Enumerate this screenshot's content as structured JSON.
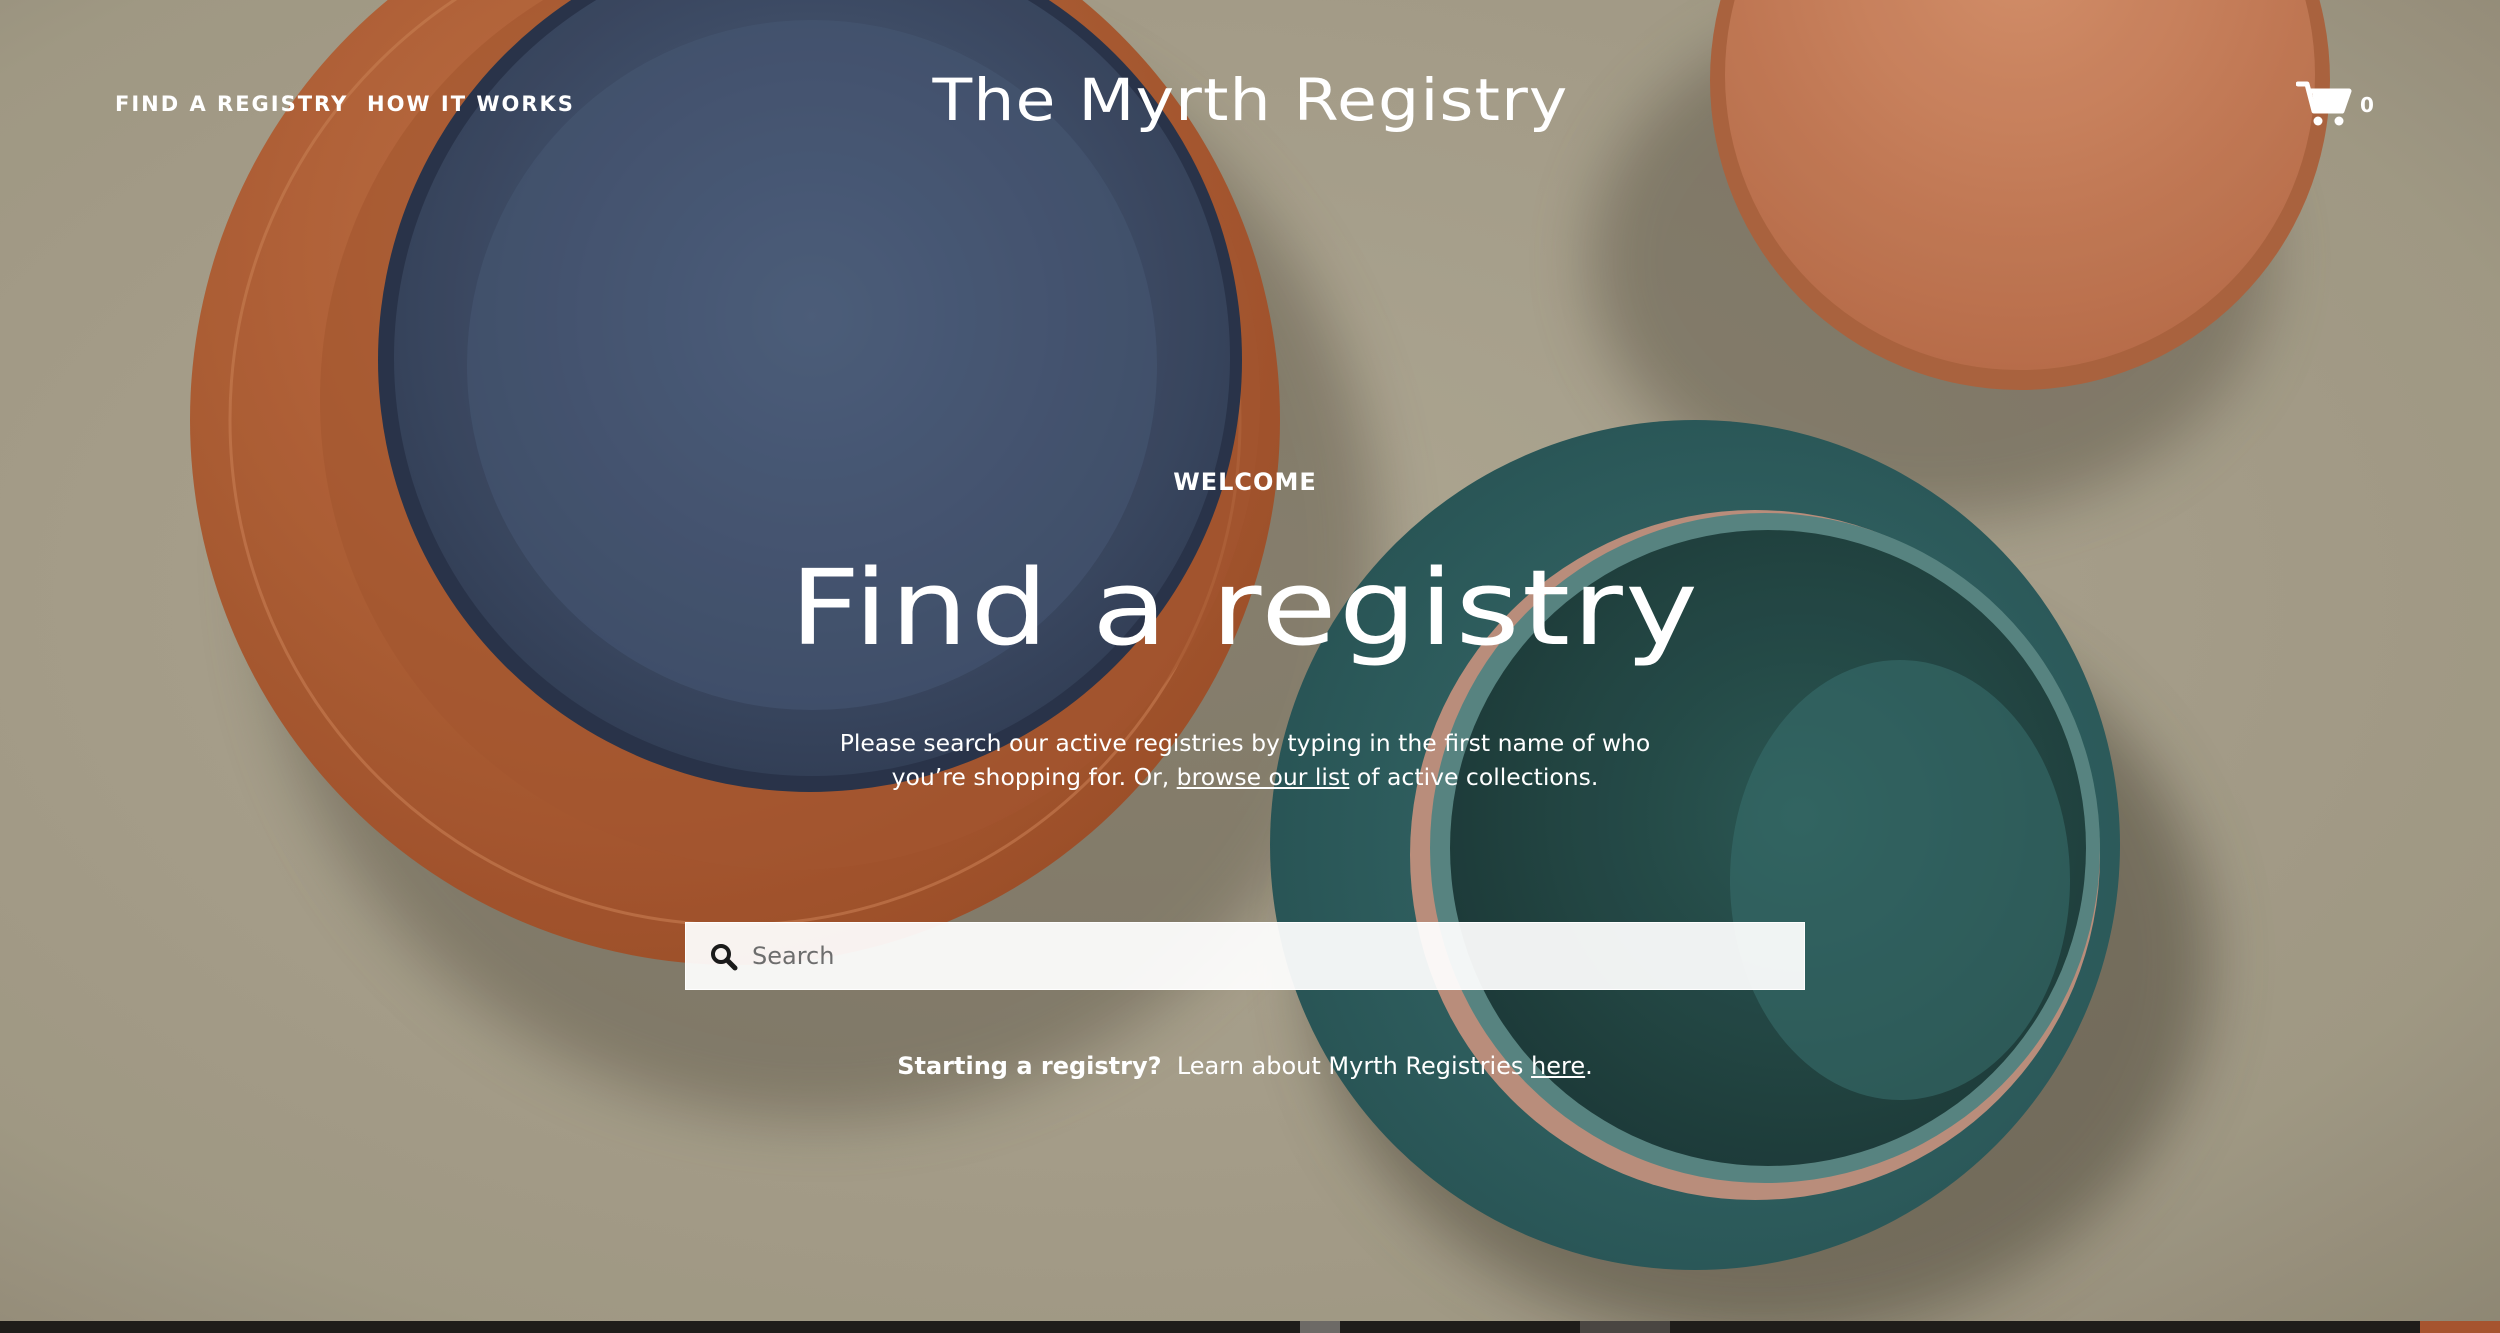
{
  "nav": {
    "find_registry": "FIND A REGISTRY",
    "how_it_works": "HOW IT WORKS"
  },
  "brand": {
    "name": "The Myrth Registry"
  },
  "cart": {
    "icon": "cart-icon",
    "count": "0"
  },
  "hero": {
    "eyebrow": "WELCOME",
    "title": "Find a registry",
    "desc_before": "Please search our active registries by typing in the first name of who you’re shopping for. Or, ",
    "desc_link": "browse our list",
    "desc_after": " of active collections."
  },
  "search": {
    "icon": "search-icon",
    "placeholder": "Search",
    "value": ""
  },
  "cta": {
    "bold": "Starting a registry?",
    "text": "  Learn about Myrth Registries ",
    "link": "here",
    "end": "."
  },
  "colors": {
    "background": "#b3ab95",
    "terracotta": "#bf6a3d",
    "navy_plate": "#445472",
    "teal_bowl": "#3f7a7a",
    "text": "#ffffff"
  }
}
